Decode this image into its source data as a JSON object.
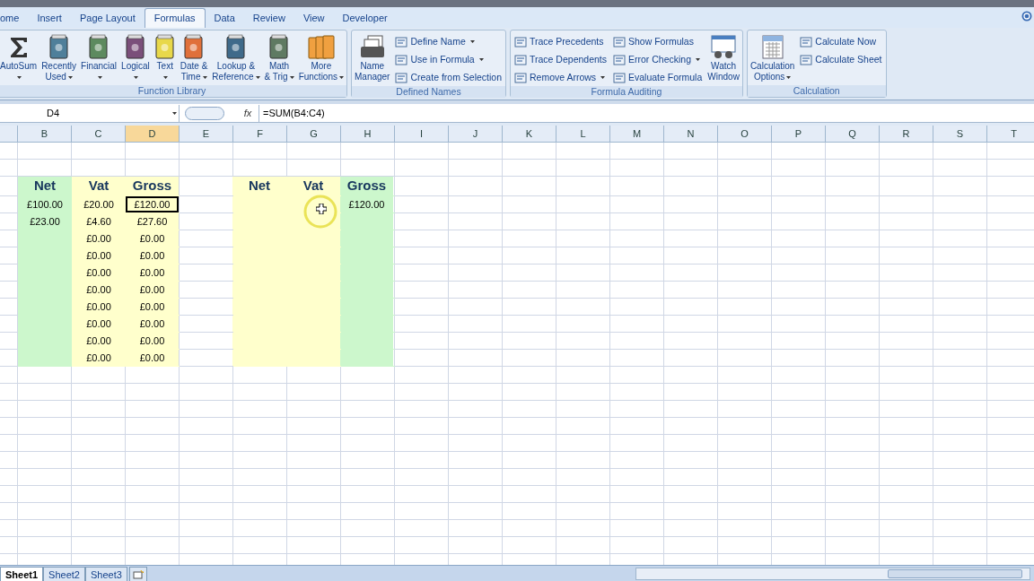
{
  "tabs": [
    {
      "label": "ome",
      "selected": false
    },
    {
      "label": "Insert",
      "selected": false
    },
    {
      "label": "Page Layout",
      "selected": false
    },
    {
      "label": "Formulas",
      "selected": true
    },
    {
      "label": "Data",
      "selected": false
    },
    {
      "label": "Review",
      "selected": false
    },
    {
      "label": "View",
      "selected": false
    },
    {
      "label": "Developer",
      "selected": false
    }
  ],
  "ribbon_groups": [
    {
      "label": "Function Library",
      "columns": [
        {
          "kind": "sigma",
          "lines": [
            "AutoSum"
          ],
          "dropdown": true
        },
        {
          "kind": "book",
          "color": "#4f7f9a",
          "lines": [
            "Recently",
            "Used"
          ],
          "dropdown": true
        },
        {
          "kind": "book",
          "color": "#5d8a5f",
          "lines": [
            "Financial"
          ],
          "dropdown": true
        },
        {
          "kind": "book",
          "color": "#7a4f7a",
          "lines": [
            "Logical"
          ],
          "dropdown": true
        },
        {
          "kind": "book",
          "color": "#e8d84a",
          "lines": [
            "Text"
          ],
          "dropdown": true
        },
        {
          "kind": "book",
          "color": "#e0703a",
          "lines": [
            "Date &",
            "Time"
          ],
          "dropdown": true
        },
        {
          "kind": "book",
          "color": "#3f6a8a",
          "lines": [
            "Lookup &",
            "Reference"
          ],
          "dropdown": true
        },
        {
          "kind": "book",
          "color": "#5f7a62",
          "lines": [
            "Math",
            "& Trig"
          ],
          "dropdown": true
        },
        {
          "kind": "books",
          "color": "#f0a040",
          "lines": [
            "More",
            "Functions"
          ],
          "dropdown": true
        }
      ]
    },
    {
      "label": "Defined Names",
      "columns": [
        {
          "kind": "cards",
          "lines": [
            "Name",
            "Manager"
          ],
          "dropdown": false
        },
        {
          "kind": "stack",
          "items": [
            {
              "label": "Define Name",
              "dropdown": true
            },
            {
              "label": "Use in Formula",
              "dropdown": true
            },
            {
              "label": "Create from Selection",
              "dropdown": false
            }
          ]
        }
      ]
    },
    {
      "label": "Formula Auditing",
      "columns": [
        {
          "kind": "stack",
          "items": [
            {
              "label": "Trace Precedents",
              "dropdown": false
            },
            {
              "label": "Trace Dependents",
              "dropdown": false
            },
            {
              "label": "Remove Arrows",
              "dropdown": true
            }
          ]
        },
        {
          "kind": "stack",
          "items": [
            {
              "label": "Show Formulas",
              "dropdown": false
            },
            {
              "label": "Error Checking",
              "dropdown": true
            },
            {
              "label": "Evaluate Formula",
              "dropdown": false
            }
          ]
        },
        {
          "kind": "watch",
          "lines": [
            "Watch",
            "Window"
          ],
          "dropdown": false
        }
      ]
    },
    {
      "label": "Calculation",
      "columns": [
        {
          "kind": "calc",
          "lines": [
            "Calculation",
            "Options"
          ],
          "dropdown": true
        },
        {
          "kind": "stack",
          "items": [
            {
              "label": "Calculate Now",
              "dropdown": false
            },
            {
              "label": "Calculate Sheet",
              "dropdown": false
            }
          ]
        }
      ]
    }
  ],
  "formula_bar": {
    "name_box": "D4",
    "fx": "fx",
    "formula": "=SUM(B4:C4)"
  },
  "columns": [
    {
      "selected": false
    },
    {
      "label": "B",
      "selected": false,
      "color": "#ccf7cc"
    },
    {
      "label": "C",
      "selected": false,
      "color": "#ffffcc"
    },
    {
      "label": "D",
      "selected": true,
      "color": "#ffffcc"
    },
    {
      "label": "E",
      "selected": false
    },
    {
      "label": "F",
      "selected": false,
      "color": "#ffffcc"
    },
    {
      "label": "G",
      "selected": false,
      "color": "#ffffcc"
    },
    {
      "label": "H",
      "selected": false,
      "color": "#ccf7cc"
    },
    {
      "label": "I",
      "selected": false
    },
    {
      "label": "J",
      "selected": false
    },
    {
      "label": "K",
      "selected": false
    },
    {
      "label": "L",
      "selected": false
    },
    {
      "label": "M",
      "selected": false
    },
    {
      "label": "N",
      "selected": false
    },
    {
      "label": "O",
      "selected": false
    },
    {
      "label": "P",
      "selected": false
    },
    {
      "label": "Q",
      "selected": false
    },
    {
      "label": "R",
      "selected": false
    },
    {
      "label": "S",
      "selected": false
    },
    {
      "label": "T",
      "selected": false
    }
  ],
  "rows": [
    {
      "kind": "blank",
      "cells": []
    },
    {
      "kind": "blank",
      "cells": []
    },
    {
      "kind": "header",
      "cells": [
        null,
        {
          "text": "Net",
          "selected": false
        },
        {
          "text": "Vat",
          "selected": false
        },
        {
          "text": "Gross",
          "selected": false
        },
        null,
        {
          "text": "Net",
          "selected": false
        },
        {
          "text": "Vat",
          "selected": false
        },
        {
          "text": "Gross",
          "selected": false
        }
      ]
    },
    {
      "kind": "data",
      "cells": [
        null,
        {
          "text": "£100.00",
          "selected": false
        },
        {
          "text": "£20.00",
          "selected": false
        },
        {
          "text": "£120.00",
          "selected": true
        },
        null,
        null,
        null,
        {
          "text": "£120.00",
          "selected": false
        }
      ]
    },
    {
      "kind": "data",
      "cells": [
        null,
        {
          "text": "£23.00",
          "selected": false
        },
        {
          "text": "£4.60",
          "selected": false
        },
        {
          "text": "£27.60",
          "selected": false
        }
      ]
    },
    {
      "kind": "data",
      "cells": [
        null,
        null,
        {
          "text": "£0.00",
          "selected": false
        },
        {
          "text": "£0.00",
          "selected": false
        }
      ]
    },
    {
      "kind": "data",
      "cells": [
        null,
        null,
        {
          "text": "£0.00",
          "selected": false
        },
        {
          "text": "£0.00",
          "selected": false
        }
      ]
    },
    {
      "kind": "data",
      "cells": [
        null,
        null,
        {
          "text": "£0.00",
          "selected": false
        },
        {
          "text": "£0.00",
          "selected": false
        }
      ]
    },
    {
      "kind": "data",
      "cells": [
        null,
        null,
        {
          "text": "£0.00",
          "selected": false
        },
        {
          "text": "£0.00",
          "selected": false
        }
      ]
    },
    {
      "kind": "data",
      "cells": [
        null,
        null,
        {
          "text": "£0.00",
          "selected": false
        },
        {
          "text": "£0.00",
          "selected": false
        }
      ]
    },
    {
      "kind": "data",
      "cells": [
        null,
        null,
        {
          "text": "£0.00",
          "selected": false
        },
        {
          "text": "£0.00",
          "selected": false
        }
      ]
    },
    {
      "kind": "data",
      "cells": [
        null,
        null,
        {
          "text": "£0.00",
          "selected": false
        },
        {
          "text": "£0.00",
          "selected": false
        }
      ]
    },
    {
      "kind": "data",
      "cells": [
        null,
        null,
        {
          "text": "£0.00",
          "selected": false
        },
        {
          "text": "£0.00",
          "selected": false
        }
      ]
    }
  ],
  "sheet_tabs": [
    {
      "label": "Sheet1",
      "selected": true
    },
    {
      "label": "Sheet2",
      "selected": false
    },
    {
      "label": "Sheet3",
      "selected": false
    }
  ]
}
